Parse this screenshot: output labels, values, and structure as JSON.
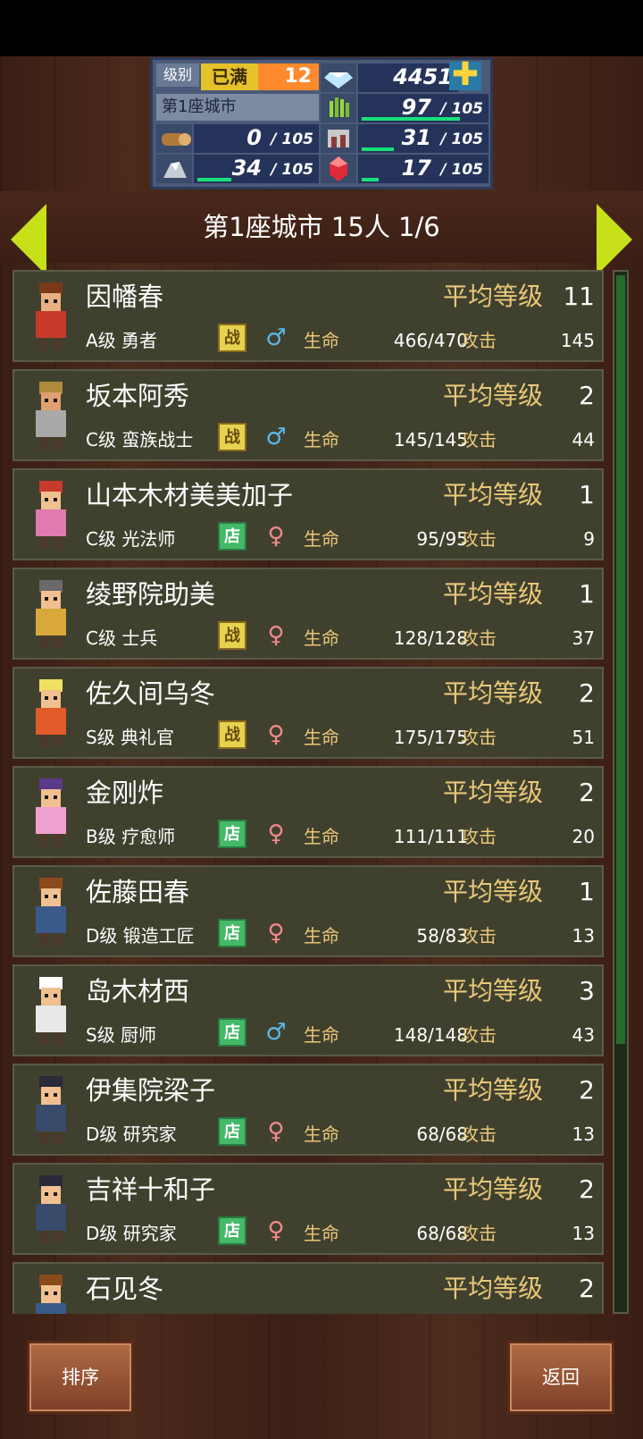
{
  "hud": {
    "level_label": "级别",
    "level_max": "已满",
    "level": "12",
    "gems": "4451",
    "plus": "✚",
    "city_label": "第1座城市",
    "resources": [
      {
        "icon": "grass-icon",
        "value": "97",
        "max": "/ 105",
        "fill": 0.92
      },
      {
        "icon": "wood-icon",
        "value": "0",
        "max": "/ 105",
        "fill": 0
      },
      {
        "icon": "food-icon",
        "value": "31",
        "max": "/ 105",
        "fill": 0.3
      },
      {
        "icon": "ore-icon",
        "value": "34",
        "max": "/ 105",
        "fill": 0.32
      },
      {
        "icon": "crystal-icon",
        "value": "17",
        "max": "/ 105",
        "fill": 0.16
      }
    ]
  },
  "title": "第1座城市  15人 1/6",
  "labels": {
    "avg_level": "平均等级",
    "hp": "生命",
    "attack": "攻击",
    "badge_war": "战",
    "badge_shop": "店"
  },
  "members": [
    {
      "name": "因幡春",
      "avg": "11",
      "cls": "A级 勇者",
      "badge": "war",
      "gender": "male",
      "hp": "466/470",
      "atk": "145",
      "skin": "#e8b080",
      "hair": "#7a3a18",
      "cloth": "#c83a2a"
    },
    {
      "name": "坂本阿秀",
      "avg": "2",
      "cls": "C级 蛮族战士",
      "badge": "war",
      "gender": "male",
      "hp": "145/145",
      "atk": "44",
      "skin": "#e0a070",
      "hair": "#b08a3a",
      "cloth": "#a8a8a8"
    },
    {
      "name": "山本木材美美加子",
      "avg": "1",
      "cls": "C级 光法师",
      "badge": "shop",
      "gender": "female",
      "hp": "95/95",
      "atk": "9",
      "skin": "#f0c090",
      "hair": "#c83a2a",
      "cloth": "#e07ab0"
    },
    {
      "name": "绫野院助美",
      "avg": "1",
      "cls": "C级 士兵",
      "badge": "war",
      "gender": "female",
      "hp": "128/128",
      "atk": "37",
      "skin": "#f0c090",
      "hair": "#6a6a6a",
      "cloth": "#d8a83a"
    },
    {
      "name": "佐久间乌冬",
      "avg": "2",
      "cls": "S级 典礼官",
      "badge": "war",
      "gender": "female",
      "hp": "175/175",
      "atk": "51",
      "skin": "#f0c090",
      "hair": "#f0e060",
      "cloth": "#e05a2a"
    },
    {
      "name": "金刚炸",
      "avg": "2",
      "cls": "B级 疗愈师",
      "badge": "shop",
      "gender": "female",
      "hp": "111/111",
      "atk": "20",
      "skin": "#f0c090",
      "hair": "#5a3a8a",
      "cloth": "#f0a0d0"
    },
    {
      "name": "佐藤田春",
      "avg": "1",
      "cls": "D级 锻造工匠",
      "badge": "shop",
      "gender": "female",
      "hp": "58/83",
      "atk": "13",
      "skin": "#f0c090",
      "hair": "#8a4a1a",
      "cloth": "#3a5a8a"
    },
    {
      "name": "岛木材西",
      "avg": "3",
      "cls": "S级 厨师",
      "badge": "shop",
      "gender": "male",
      "hp": "148/148",
      "atk": "43",
      "skin": "#f0c090",
      "hair": "#ffffff",
      "cloth": "#e8e8e8"
    },
    {
      "name": "伊集院梁子",
      "avg": "2",
      "cls": "D级 研究家",
      "badge": "shop",
      "gender": "female",
      "hp": "68/68",
      "atk": "13",
      "skin": "#f0c090",
      "hair": "#2a2a3a",
      "cloth": "#3a4a6a"
    },
    {
      "name": "吉祥十和子",
      "avg": "2",
      "cls": "D级 研究家",
      "badge": "shop",
      "gender": "female",
      "hp": "68/68",
      "atk": "13",
      "skin": "#f0c090",
      "hair": "#2a2a3a",
      "cloth": "#3a4a6a"
    },
    {
      "name": "石见冬",
      "avg": "2",
      "cls": "",
      "badge": "",
      "gender": "",
      "hp": "",
      "atk": "",
      "skin": "#f0c090",
      "hair": "#8a4a1a",
      "cloth": "#3a5a8a"
    }
  ],
  "buttons": {
    "sort": "排序",
    "back": "返回"
  },
  "colors": {
    "accent_arrow": "#c8e01a",
    "gold_label": "#e8c878",
    "bar_green": "#18e07a"
  }
}
